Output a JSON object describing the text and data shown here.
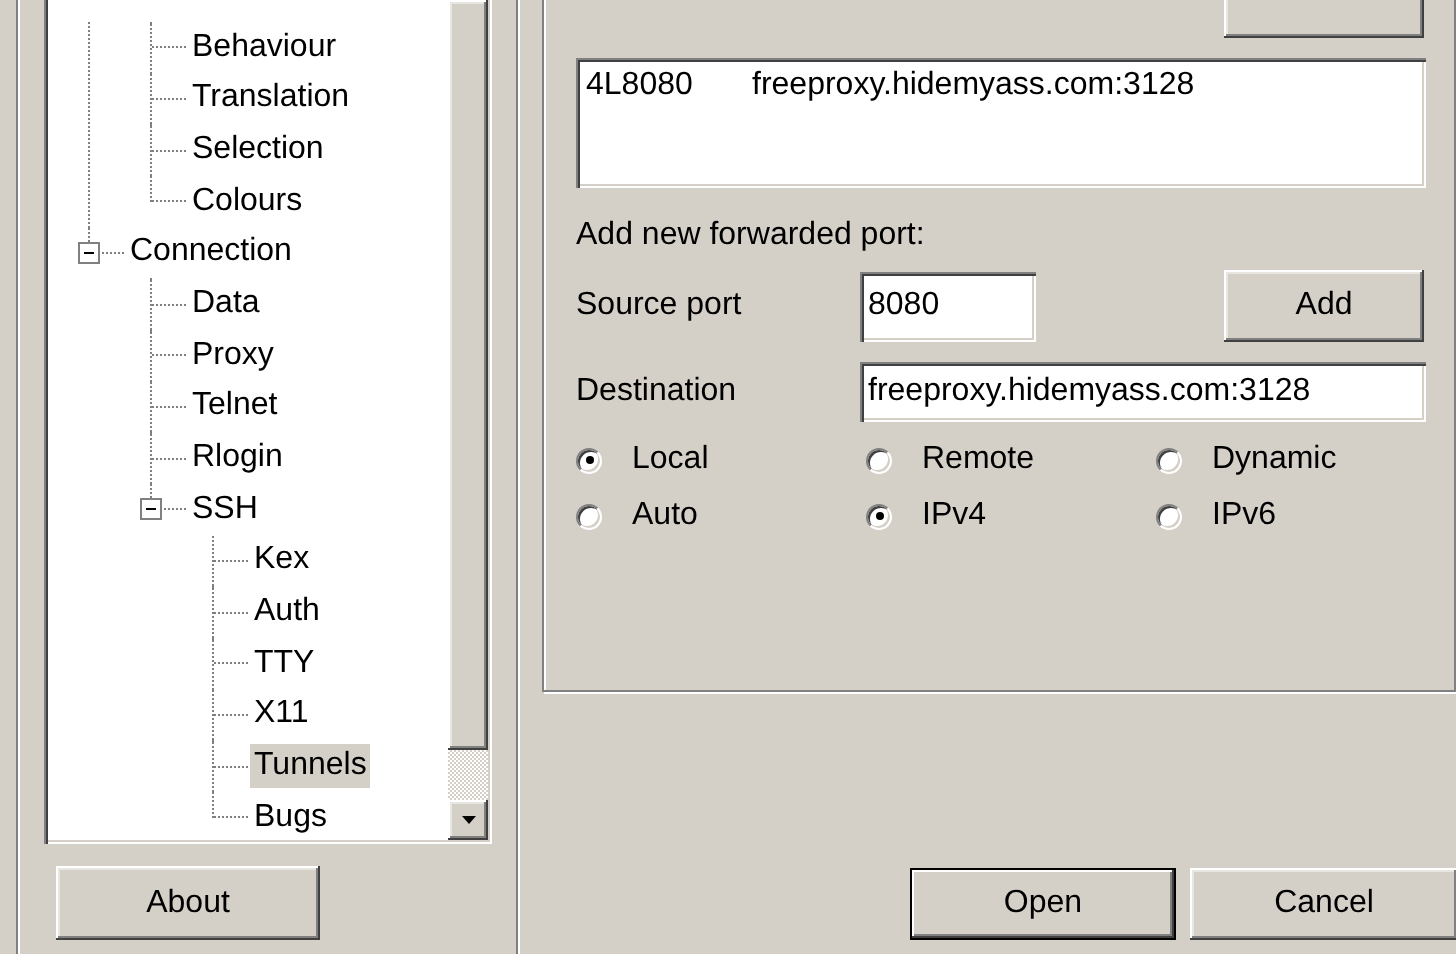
{
  "tree": {
    "items": [
      {
        "children": [
          {
            "label": "Behaviour",
            "selected": false
          },
          {
            "label": "Translation",
            "selected": false
          },
          {
            "label": "Selection",
            "selected": false
          },
          {
            "label": "Colours",
            "selected": false
          }
        ]
      },
      {
        "label": "Connection",
        "expanded": true,
        "selected": false,
        "children": [
          {
            "label": "Data",
            "selected": false
          },
          {
            "label": "Proxy",
            "selected": false
          },
          {
            "label": "Telnet",
            "selected": false
          },
          {
            "label": "Rlogin",
            "selected": false
          },
          {
            "label": "SSH",
            "expanded": true,
            "selected": false,
            "children": [
              {
                "label": "Kex",
                "selected": false
              },
              {
                "label": "Auth",
                "selected": false
              },
              {
                "label": "TTY",
                "selected": false
              },
              {
                "label": "X11",
                "selected": false
              },
              {
                "label": "Tunnels",
                "selected": true
              },
              {
                "label": "Bugs",
                "selected": false
              }
            ]
          }
        ]
      }
    ]
  },
  "about_button": "About",
  "forwarded_ports": {
    "rows": [
      {
        "source": "4L8080",
        "destination": "freeproxy.hidemyass.com:3128"
      }
    ]
  },
  "add_heading": "Add new forwarded port:",
  "source_port": {
    "label": "Source port",
    "value": "8080"
  },
  "add_button": "Add",
  "destination": {
    "label": "Destination",
    "value": "freeproxy.hidemyass.com:3128"
  },
  "direction": [
    {
      "label": "Local",
      "selected": true
    },
    {
      "label": "Remote",
      "selected": false
    },
    {
      "label": "Dynamic",
      "selected": false
    }
  ],
  "ip_version": [
    {
      "label": "Auto",
      "selected": false
    },
    {
      "label": "IPv4",
      "selected": true
    },
    {
      "label": "IPv6",
      "selected": false
    }
  ],
  "buttons": [
    {
      "label": "Open",
      "default": true
    },
    {
      "label": "Cancel",
      "default": false
    }
  ]
}
